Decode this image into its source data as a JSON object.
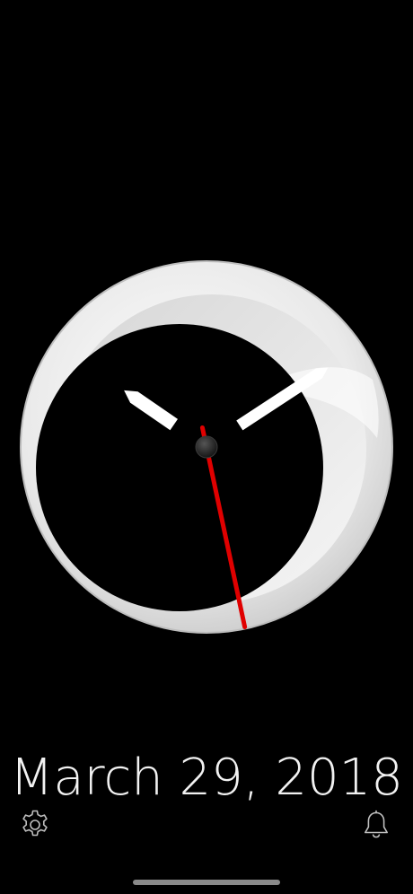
{
  "clock": {
    "time": {
      "hour": 10,
      "minute": 9,
      "second": 28
    },
    "colors": {
      "bezel": "#ececec",
      "face": "#000000",
      "hands": "#ffffff",
      "second_hand": "#e00000"
    }
  },
  "date": {
    "label": "March 29, 2018"
  },
  "toolbar": {
    "settings_icon": "gear-icon",
    "alarm_icon": "bell-icon"
  }
}
